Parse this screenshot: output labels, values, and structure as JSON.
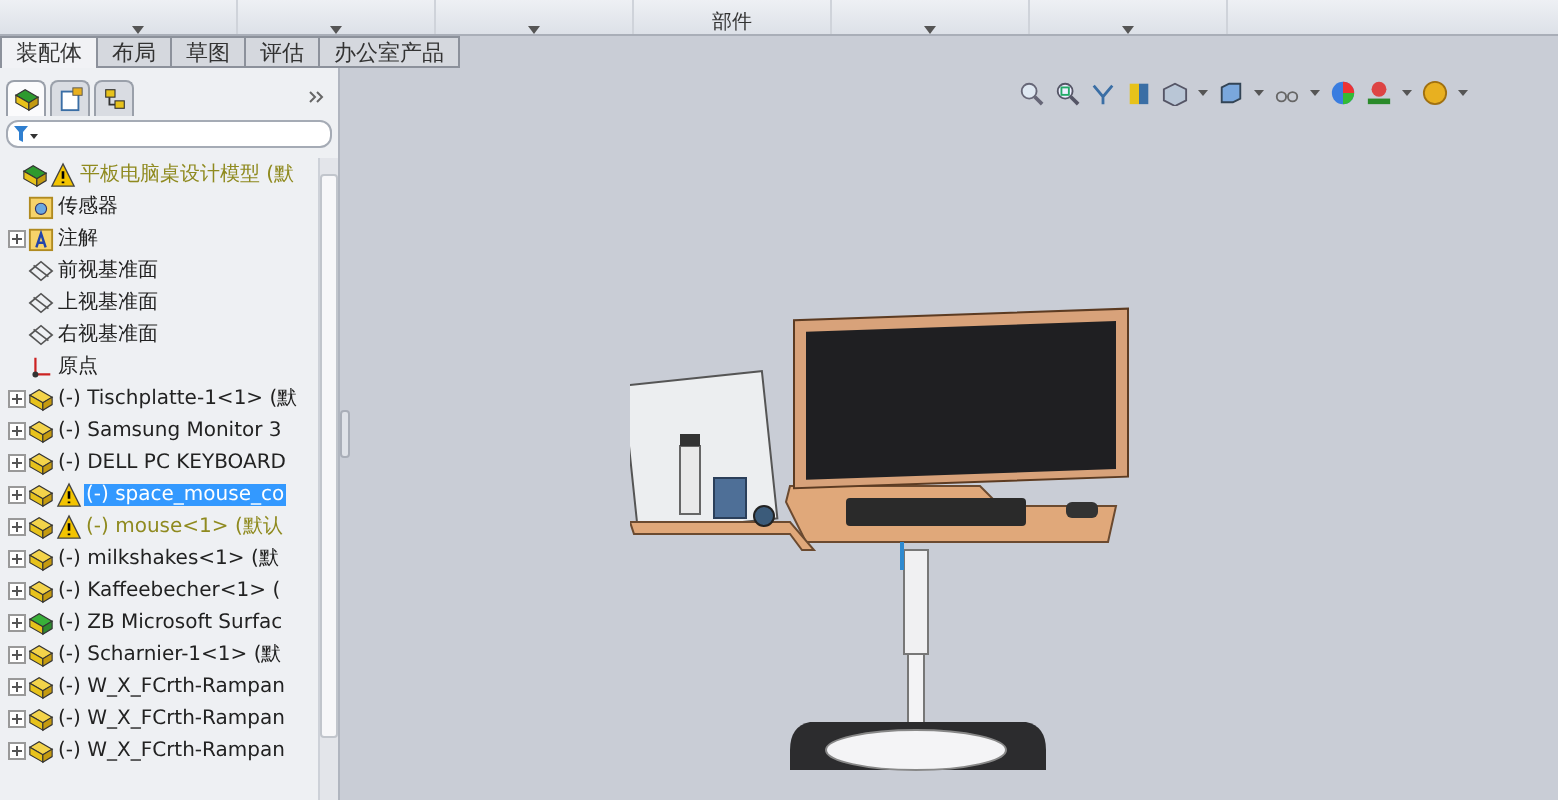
{
  "ribbon": {
    "buttons": [
      {
        "has_menu": true
      },
      {
        "has_menu": true
      },
      {
        "has_menu": true
      },
      {
        "label": "部件",
        "has_menu": false
      },
      {
        "has_menu": true
      },
      {
        "has_menu": true
      }
    ]
  },
  "tabs": [
    {
      "label": "装配体",
      "selected": true
    },
    {
      "label": "布局",
      "selected": false
    },
    {
      "label": "草图",
      "selected": false
    },
    {
      "label": "评估",
      "selected": false
    },
    {
      "label": "办公室产品",
      "selected": false
    }
  ],
  "panel_tabs": [
    {
      "kind": "tree",
      "selected": true
    },
    {
      "kind": "properties",
      "selected": false
    },
    {
      "kind": "config",
      "selected": false
    }
  ],
  "tree": {
    "label": "平板电脑桌设计模型 (默",
    "kind": "assembly",
    "warning": true,
    "selected": false,
    "children": [
      {
        "label": "传感器",
        "kind": "sensor",
        "warning": false,
        "selected": false,
        "expandable": false
      },
      {
        "label": "注解",
        "kind": "annotation",
        "warning": false,
        "selected": false,
        "expandable": true
      },
      {
        "label": "前视基准面",
        "kind": "plane",
        "warning": false,
        "selected": false,
        "expandable": false
      },
      {
        "label": "上视基准面",
        "kind": "plane",
        "warning": false,
        "selected": false,
        "expandable": false
      },
      {
        "label": "右视基准面",
        "kind": "plane",
        "warning": false,
        "selected": false,
        "expandable": false
      },
      {
        "label": "原点",
        "kind": "origin",
        "warning": false,
        "selected": false,
        "expandable": false
      },
      {
        "label": "(-) Tischplatte-1<1> (默",
        "kind": "part",
        "warning": false,
        "selected": false,
        "expandable": true
      },
      {
        "label": "(-) Samsung Monitor 3",
        "kind": "part",
        "warning": false,
        "selected": false,
        "expandable": true
      },
      {
        "label": "(-) DELL PC KEYBOARD",
        "kind": "part",
        "warning": false,
        "selected": false,
        "expandable": true
      },
      {
        "label": "(-) space_mouse_co",
        "kind": "part",
        "warning": true,
        "selected": true,
        "expandable": true
      },
      {
        "label": "(-) mouse<1> (默认",
        "kind": "part",
        "warning": true,
        "selected": false,
        "expandable": true
      },
      {
        "label": "(-) milkshakes<1> (默",
        "kind": "part",
        "warning": false,
        "selected": false,
        "expandable": true
      },
      {
        "label": "(-) Kaffeebecher<1> (",
        "kind": "part",
        "warning": false,
        "selected": false,
        "expandable": true
      },
      {
        "label": "(-) ZB Microsoft Surfac",
        "kind": "surface",
        "warning": false,
        "selected": false,
        "expandable": true
      },
      {
        "label": "(-) Scharnier-1<1> (默",
        "kind": "part",
        "warning": false,
        "selected": false,
        "expandable": true
      },
      {
        "label": "(-) W_X_FCrth-Rampan",
        "kind": "part",
        "warning": false,
        "selected": false,
        "expandable": true
      },
      {
        "label": "(-) W_X_FCrth-Rampan",
        "kind": "part",
        "warning": false,
        "selected": false,
        "expandable": true
      },
      {
        "label": "(-) W_X_FCrth-Rampan",
        "kind": "part",
        "warning": false,
        "selected": false,
        "expandable": true
      }
    ]
  }
}
